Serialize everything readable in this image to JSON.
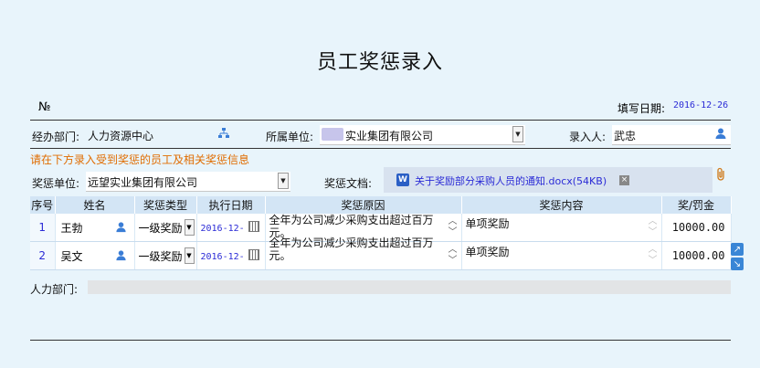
{
  "header": {
    "title": "员工奖惩录入",
    "no_label": "№",
    "fill_date_label": "填写日期:",
    "fill_date_value": "2016-12-26"
  },
  "form": {
    "dept_label": "经办部门:",
    "dept_value": "人力资源中心",
    "unit_label": "所属单位:",
    "unit_value": "实业集团有限公司",
    "entry_person_label": "录入人:",
    "entry_person_value": "武忠",
    "hint": "请在下方录入受到奖惩的员工及相关奖惩信息",
    "reward_unit_label": "奖惩单位:",
    "reward_unit_value": "远望实业集团有限公司",
    "doc_label": "奖惩文档:",
    "doc_file": "关于奖励部分采购人员的通知.docx(54KB)",
    "hr_dept_label": "人力部门:"
  },
  "table": {
    "headers": [
      "序号",
      "姓名",
      "奖惩类型",
      "执行日期",
      "奖惩原因",
      "奖惩内容",
      "奖/罚金"
    ],
    "rows": [
      {
        "seq": "1",
        "name": "王勃",
        "type": "一级奖励",
        "date": "2016-12-",
        "reason": "全年为公司减少采购支出超过百万元。",
        "content": "单项奖励",
        "amount": "10000.00"
      },
      {
        "seq": "2",
        "name": "吴文",
        "type": "一级奖励",
        "date": "2016-12-",
        "reason": "全年为公司减少采购支出超过百万元。",
        "content": "单项奖励",
        "amount": "10000.00"
      }
    ]
  },
  "colors": {
    "background": "#e8f4fb",
    "header_bg": "#d3e5f5",
    "link_blue": "#2b2bd6",
    "hint_orange": "#e06c00"
  }
}
